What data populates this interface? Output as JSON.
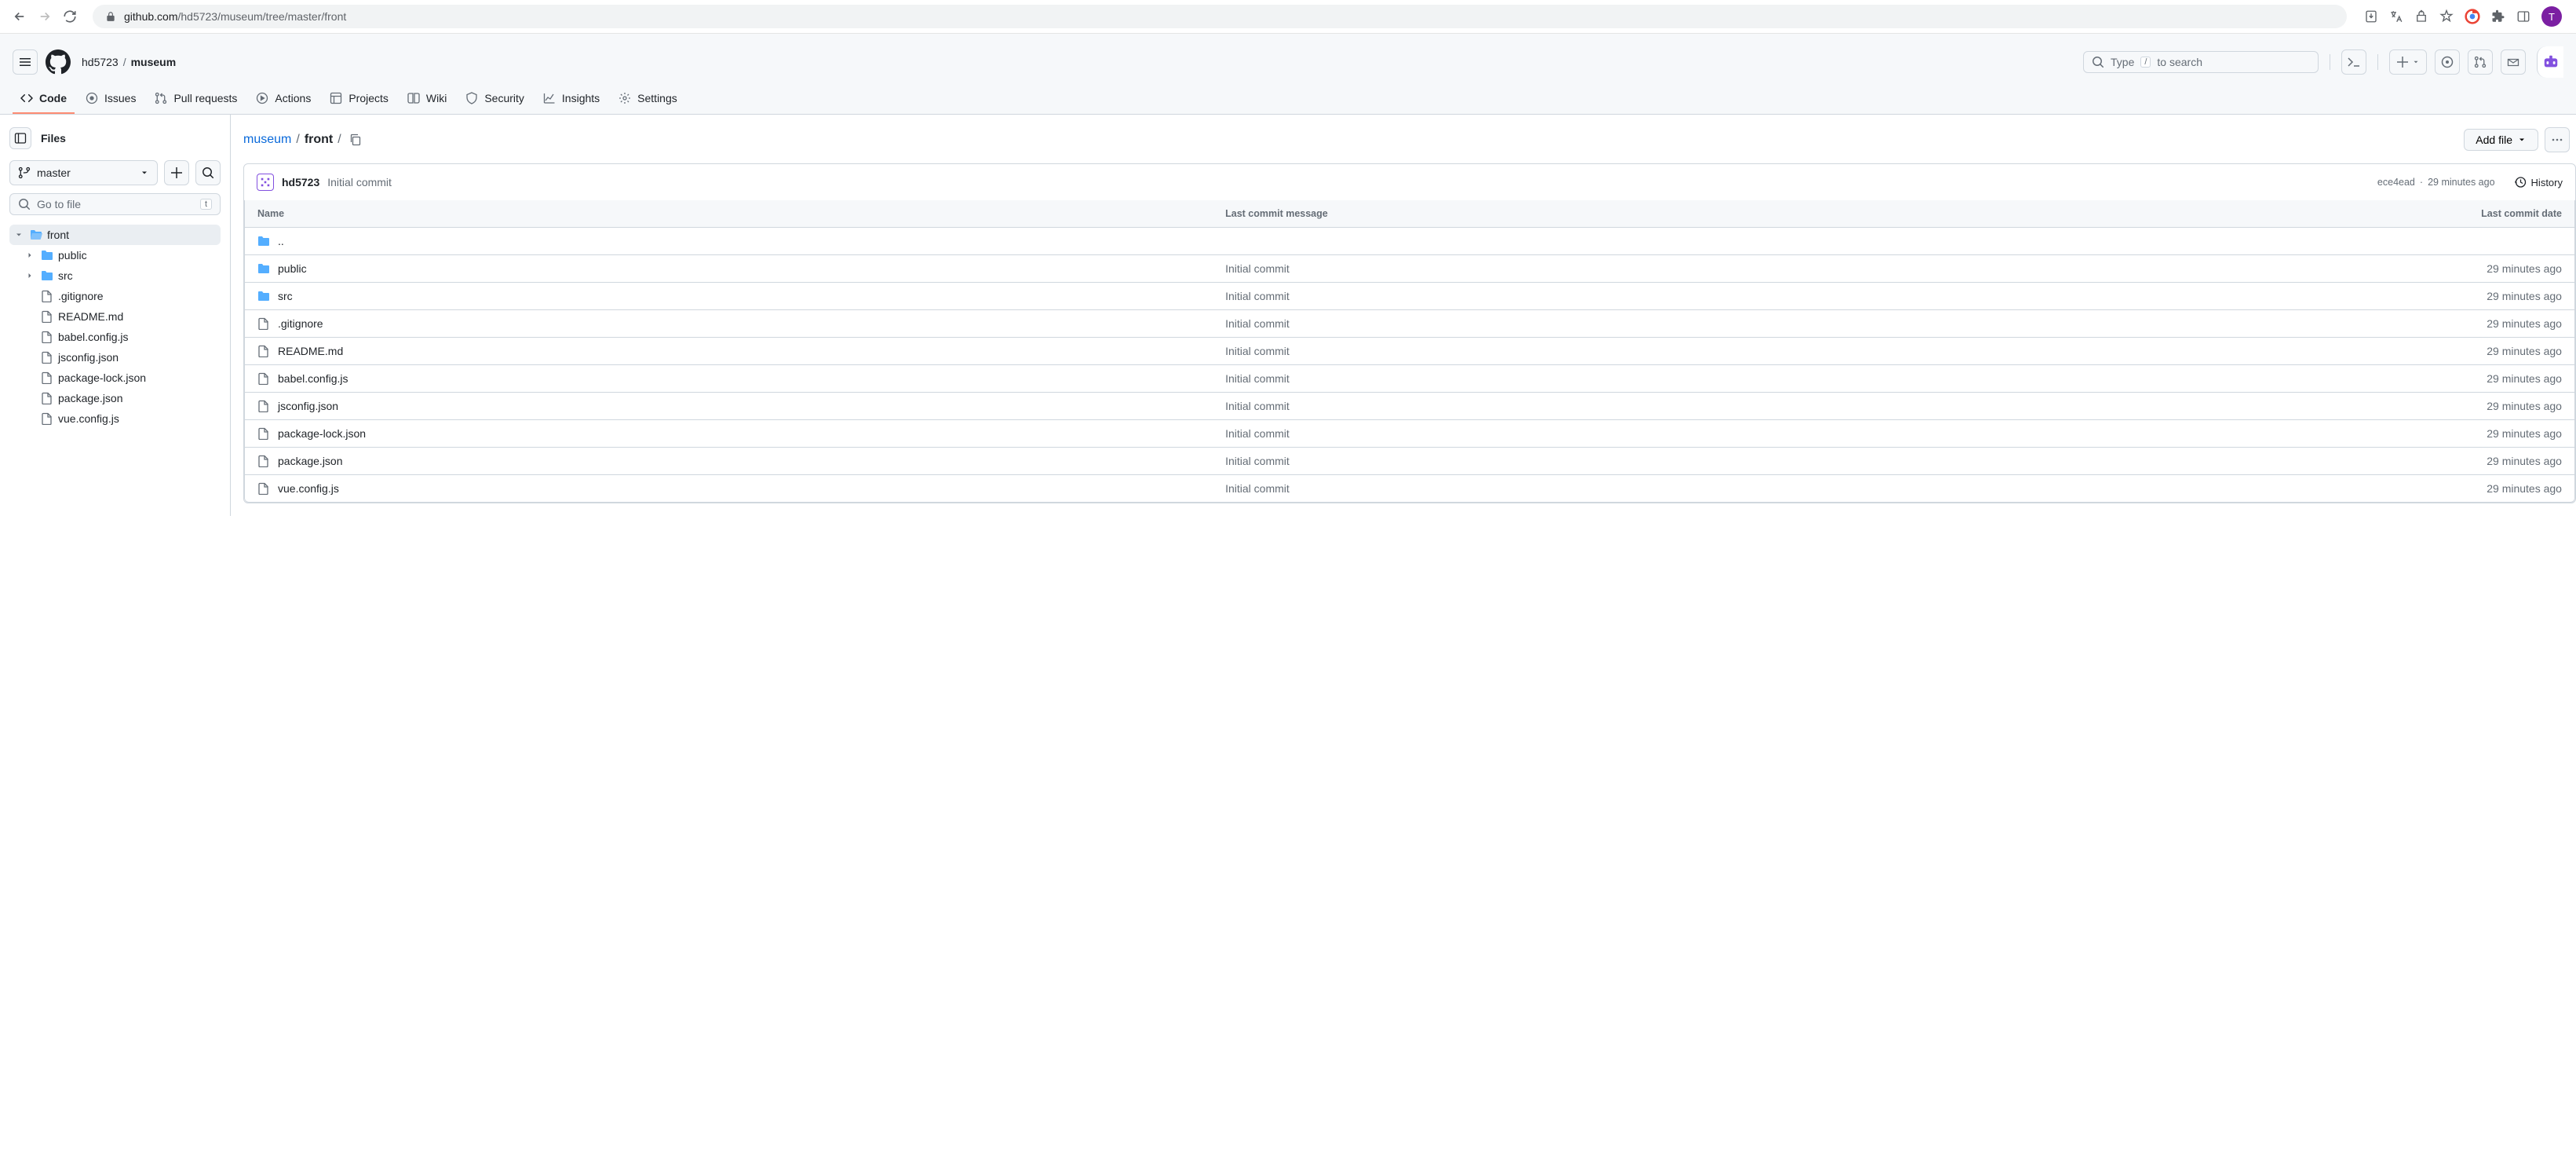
{
  "browser": {
    "url_domain": "github.com",
    "url_path": "/hd5723/museum/tree/master/front",
    "avatar_initial": "T"
  },
  "header": {
    "owner": "hd5723",
    "repo": "museum",
    "search_placeholder_pre": "Type",
    "search_kbd": "/",
    "search_placeholder_post": "to search"
  },
  "nav": {
    "code": "Code",
    "issues": "Issues",
    "pull_requests": "Pull requests",
    "actions": "Actions",
    "projects": "Projects",
    "wiki": "Wiki",
    "security": "Security",
    "insights": "Insights",
    "settings": "Settings"
  },
  "sidebar": {
    "title": "Files",
    "branch": "master",
    "file_search_placeholder": "Go to file",
    "file_search_kbd": "t",
    "tree": {
      "front": "front",
      "public": "public",
      "src": "src",
      "gitignore": ".gitignore",
      "readme": "README.md",
      "babel": "babel.config.js",
      "jsconfig": "jsconfig.json",
      "pkglock": "package-lock.json",
      "pkg": "package.json",
      "vueconfig": "vue.config.js"
    }
  },
  "breadcrumb": {
    "root": "museum",
    "current": "front",
    "add_file": "Add file"
  },
  "commit": {
    "author": "hd5723",
    "message": "Initial commit",
    "sha": "ece4ead",
    "dot": "·",
    "time": "29 minutes ago",
    "history": "History"
  },
  "table": {
    "col_name": "Name",
    "col_msg": "Last commit message",
    "col_date": "Last commit date",
    "parent": "..",
    "rows": [
      {
        "name": "public",
        "type": "folder",
        "msg": "Initial commit",
        "date": "29 minutes ago"
      },
      {
        "name": "src",
        "type": "folder",
        "msg": "Initial commit",
        "date": "29 minutes ago"
      },
      {
        "name": ".gitignore",
        "type": "file",
        "msg": "Initial commit",
        "date": "29 minutes ago"
      },
      {
        "name": "README.md",
        "type": "file",
        "msg": "Initial commit",
        "date": "29 minutes ago"
      },
      {
        "name": "babel.config.js",
        "type": "file",
        "msg": "Initial commit",
        "date": "29 minutes ago"
      },
      {
        "name": "jsconfig.json",
        "type": "file",
        "msg": "Initial commit",
        "date": "29 minutes ago"
      },
      {
        "name": "package-lock.json",
        "type": "file",
        "msg": "Initial commit",
        "date": "29 minutes ago"
      },
      {
        "name": "package.json",
        "type": "file",
        "msg": "Initial commit",
        "date": "29 minutes ago"
      },
      {
        "name": "vue.config.js",
        "type": "file",
        "msg": "Initial commit",
        "date": "29 minutes ago"
      }
    ]
  }
}
